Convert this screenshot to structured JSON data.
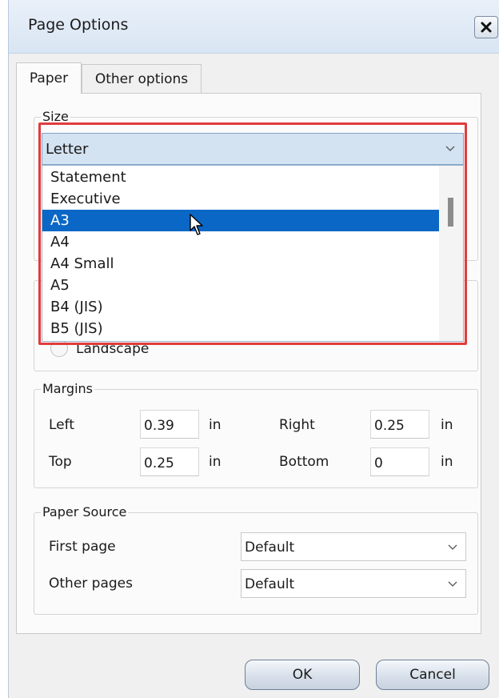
{
  "window": {
    "title": "Page Options",
    "close_icon": "close-icon"
  },
  "tabs": [
    {
      "label": "Paper",
      "active": true
    },
    {
      "label": "Other options",
      "active": false
    }
  ],
  "size_group": {
    "legend": "Size",
    "selected": "Letter",
    "options": [
      "Statement",
      "Executive",
      "A3",
      "A4",
      "A4 Small",
      "A5",
      "B4 (JIS)",
      "B5 (JIS)"
    ],
    "highlighted": "A3"
  },
  "orientation_group": {
    "landscape_label": "Landscape"
  },
  "margins_group": {
    "legend": "Margins",
    "left_label": "Left",
    "left_value": "0.39",
    "right_label": "Right",
    "right_value": "0.25",
    "top_label": "Top",
    "top_value": "0.25",
    "bottom_label": "Bottom",
    "bottom_value": "0",
    "unit": "in"
  },
  "paper_source_group": {
    "legend": "Paper Source",
    "first_page_label": "First page",
    "first_page_value": "Default",
    "other_pages_label": "Other pages",
    "other_pages_value": "Default"
  },
  "buttons": {
    "ok": "OK",
    "cancel": "Cancel"
  },
  "colors": {
    "highlight_border": "#e03c3c",
    "selected_item": "#0a67c6",
    "dropdown_header": "#d4e3f2"
  }
}
